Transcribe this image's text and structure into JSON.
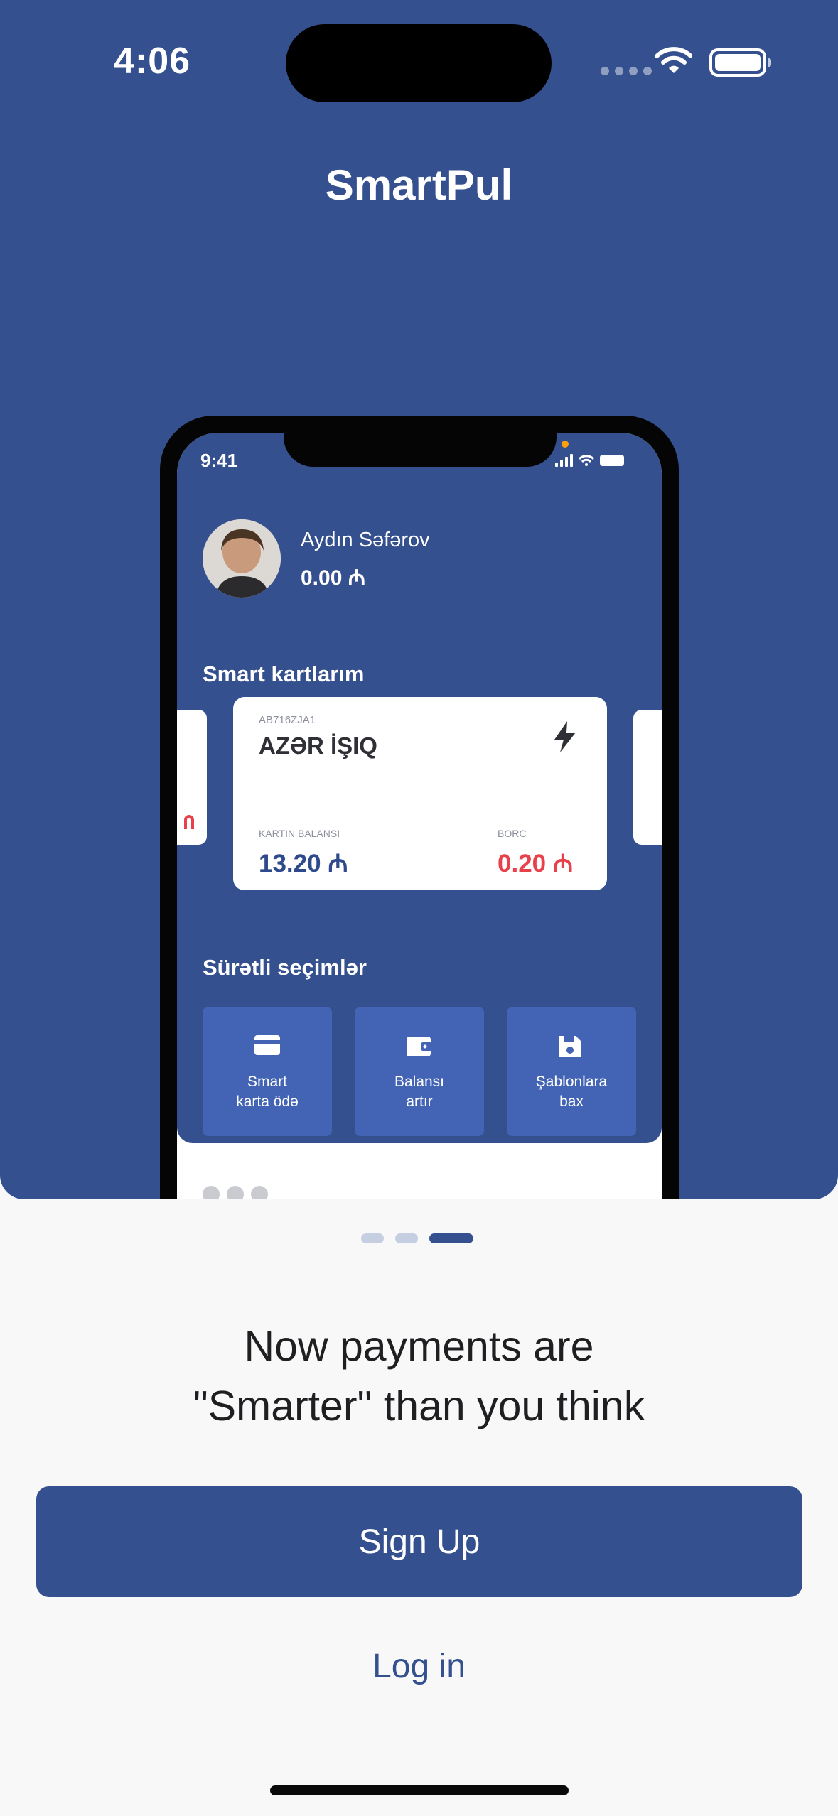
{
  "status_bar": {
    "time": "4:06"
  },
  "app": {
    "title": "SmartPul"
  },
  "mockup": {
    "status_time": "9:41",
    "user": {
      "name": "Aydın Səfərov",
      "balance": "0.00 ₼"
    },
    "cards_section_title": "Smart kartlarım",
    "card": {
      "code": "AB716ZJA1",
      "name": "AZƏR İŞIQ",
      "balance_label": "KARTIN BALANSI",
      "balance_value": "13.20 ₼",
      "debt_label": "BORC",
      "debt_value": "0.20 ₼",
      "balance_color": "#2f4a8c",
      "debt_color": "#e8414b"
    },
    "quick_section_title": "Sürətli seçimlər",
    "quick_actions": [
      {
        "label": "Smart\nkarta ödə",
        "icon": "card-icon"
      },
      {
        "label": "Balansı\nartır",
        "icon": "wallet-icon"
      },
      {
        "label": "Şablonlara\nbax",
        "icon": "save-icon"
      }
    ]
  },
  "pager": {
    "count": 3,
    "active_index": 2
  },
  "headline": "Now payments are\n\"Smarter\" than you think",
  "buttons": {
    "signup_label": "Sign Up",
    "login_label": "Log in"
  },
  "colors": {
    "primary": "#35508f",
    "background": "#f8f8f9",
    "tile": "#4364b4"
  }
}
